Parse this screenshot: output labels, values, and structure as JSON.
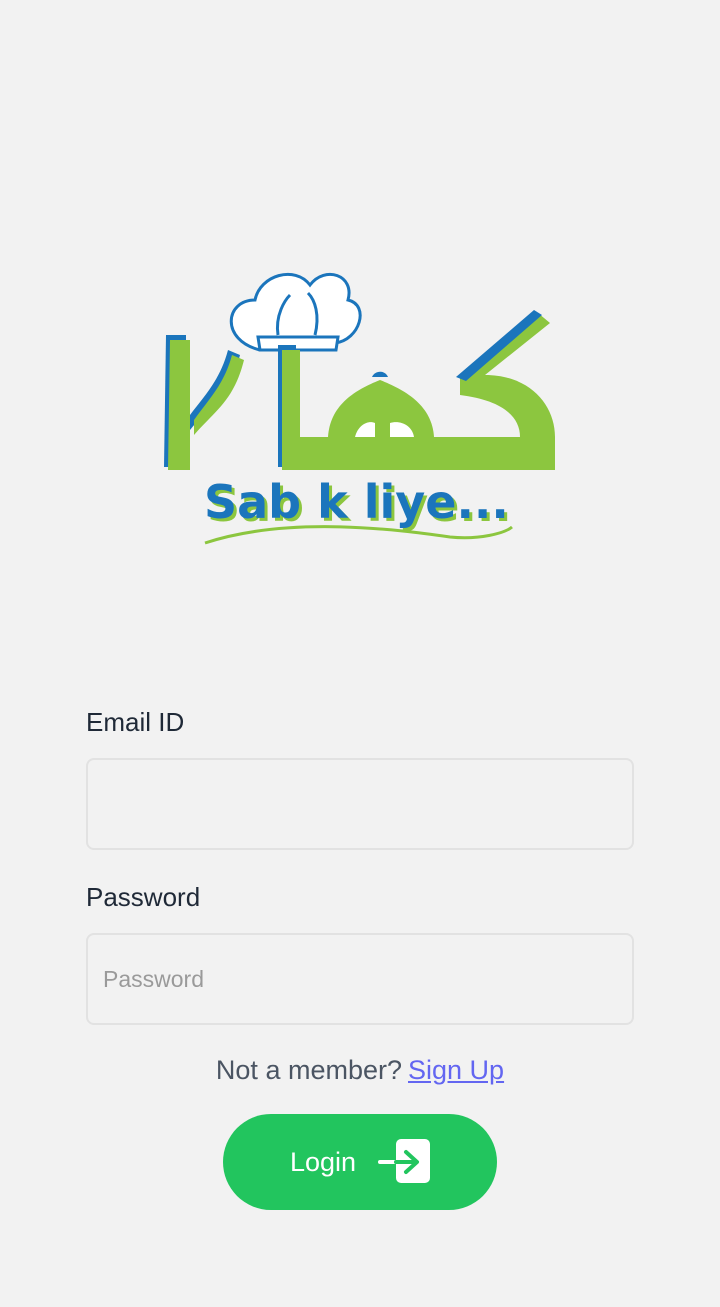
{
  "logo": {
    "tagline": "Sab k liye...",
    "brand_colors": {
      "green": "#8cc63f",
      "blue": "#1b75bc"
    }
  },
  "form": {
    "email_label": "Email ID",
    "email_value": "",
    "email_placeholder": "",
    "password_label": "Password",
    "password_value": "",
    "password_placeholder": "Password"
  },
  "signup": {
    "prompt": "Not a member?",
    "link_label": "Sign Up"
  },
  "login_button": {
    "label": "Login",
    "icon": "login-arrow-icon",
    "color": "#22c55e"
  }
}
